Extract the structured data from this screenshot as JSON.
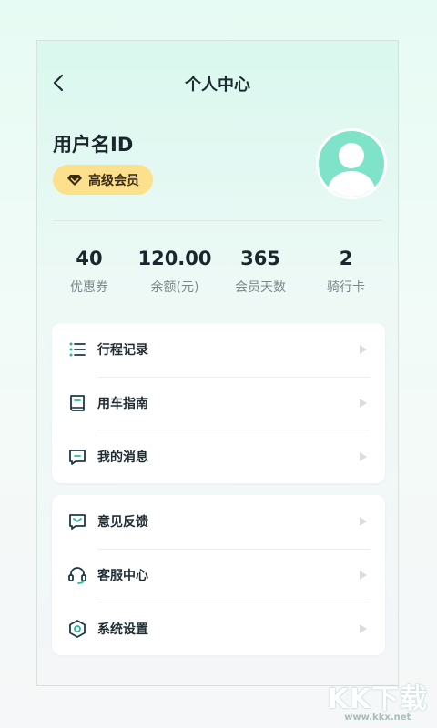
{
  "header": {
    "title": "个人中心"
  },
  "profile": {
    "username": "用户名ID",
    "badge": "高级会员"
  },
  "stats": [
    {
      "value": "40",
      "label": "优惠券"
    },
    {
      "value": "120.00",
      "label": "余额(元)"
    },
    {
      "value": "365",
      "label": "会员天数"
    },
    {
      "value": "2",
      "label": "骑行卡"
    }
  ],
  "menu1": [
    {
      "label": "行程记录",
      "icon": "list-icon"
    },
    {
      "label": "用车指南",
      "icon": "book-icon"
    },
    {
      "label": "我的消息",
      "icon": "message-icon"
    }
  ],
  "menu2": [
    {
      "label": "意见反馈",
      "icon": "feedback-icon"
    },
    {
      "label": "客服中心",
      "icon": "headset-icon"
    },
    {
      "label": "系统设置",
      "icon": "settings-icon"
    }
  ],
  "colors": {
    "accent": "#27b99a",
    "badge_bg": "#fde08b",
    "avatar_bg": "#7ee3c8"
  },
  "watermark": {
    "text": "KK下载",
    "url": "www.kkx.net"
  }
}
